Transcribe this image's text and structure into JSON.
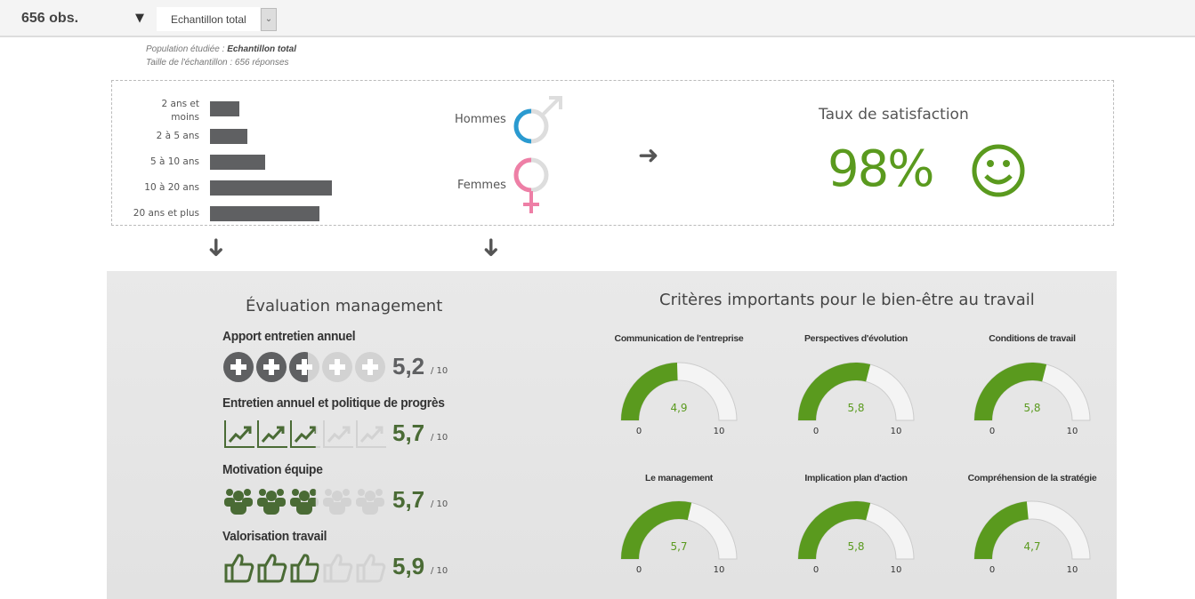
{
  "header": {
    "obs": "656 obs.",
    "filter_icon": "filter-icon",
    "select_value": "Echantillon total"
  },
  "info": {
    "population_label": "Population étudiée : ",
    "population_value": "Echantillon total",
    "sample": "Taille de l'échantillon : 656 réponses"
  },
  "seniority": {
    "items": [
      {
        "label": "2 ans et moins",
        "relative": 24
      },
      {
        "label": "2 à 5 ans",
        "relative": 31
      },
      {
        "label": "5 à 10 ans",
        "relative": 45
      },
      {
        "label": "10 à 20 ans",
        "relative": 100
      },
      {
        "label": "20 ans et plus",
        "relative": 90
      }
    ]
  },
  "gender": {
    "men": "Hommes",
    "women": "Femmes",
    "men_color": "#2a9ad0",
    "women_color": "#ee7fa6"
  },
  "satisfaction": {
    "title": "Taux de satisfaction",
    "value": "98%",
    "icon": "smiley-icon",
    "color": "#5a9a1e"
  },
  "management": {
    "title": "Évaluation  management",
    "out_of": "/ 10",
    "items": [
      {
        "label": "Apport entretien annuel",
        "score": "5,2",
        "value": 5.2,
        "icon": "plus-circle-icon",
        "color": "#5f6062"
      },
      {
        "label": "Entretien annuel et politique de progrès",
        "score": "5,7",
        "value": 5.7,
        "icon": "trend-chart-icon",
        "color": "#4a6b35"
      },
      {
        "label": "Motivation équipe",
        "score": "5,7",
        "value": 5.7,
        "icon": "team-icon",
        "color": "#4a6b35"
      },
      {
        "label": "Valorisation travail",
        "score": "5,9",
        "value": 5.9,
        "icon": "thumbs-up-icon",
        "color": "#4a6b35"
      }
    ]
  },
  "criteria": {
    "title": "Critères importants pour le bien-être au travail",
    "min": "0",
    "max": "10",
    "color": "#5a9a1e",
    "items": [
      {
        "label": "Communication de l'entreprise",
        "score": "4,9",
        "value": 4.9
      },
      {
        "label": "Perspectives d'évolution",
        "score": "5,8",
        "value": 5.8
      },
      {
        "label": "Conditions de travail",
        "score": "5,8",
        "value": 5.8
      },
      {
        "label": "Le management",
        "score": "5,7",
        "value": 5.7
      },
      {
        "label": "Implication plan d'action",
        "score": "5,8",
        "value": 5.8
      },
      {
        "label": "Compréhension de la stratégie",
        "score": "4,7",
        "value": 4.7
      }
    ]
  }
}
